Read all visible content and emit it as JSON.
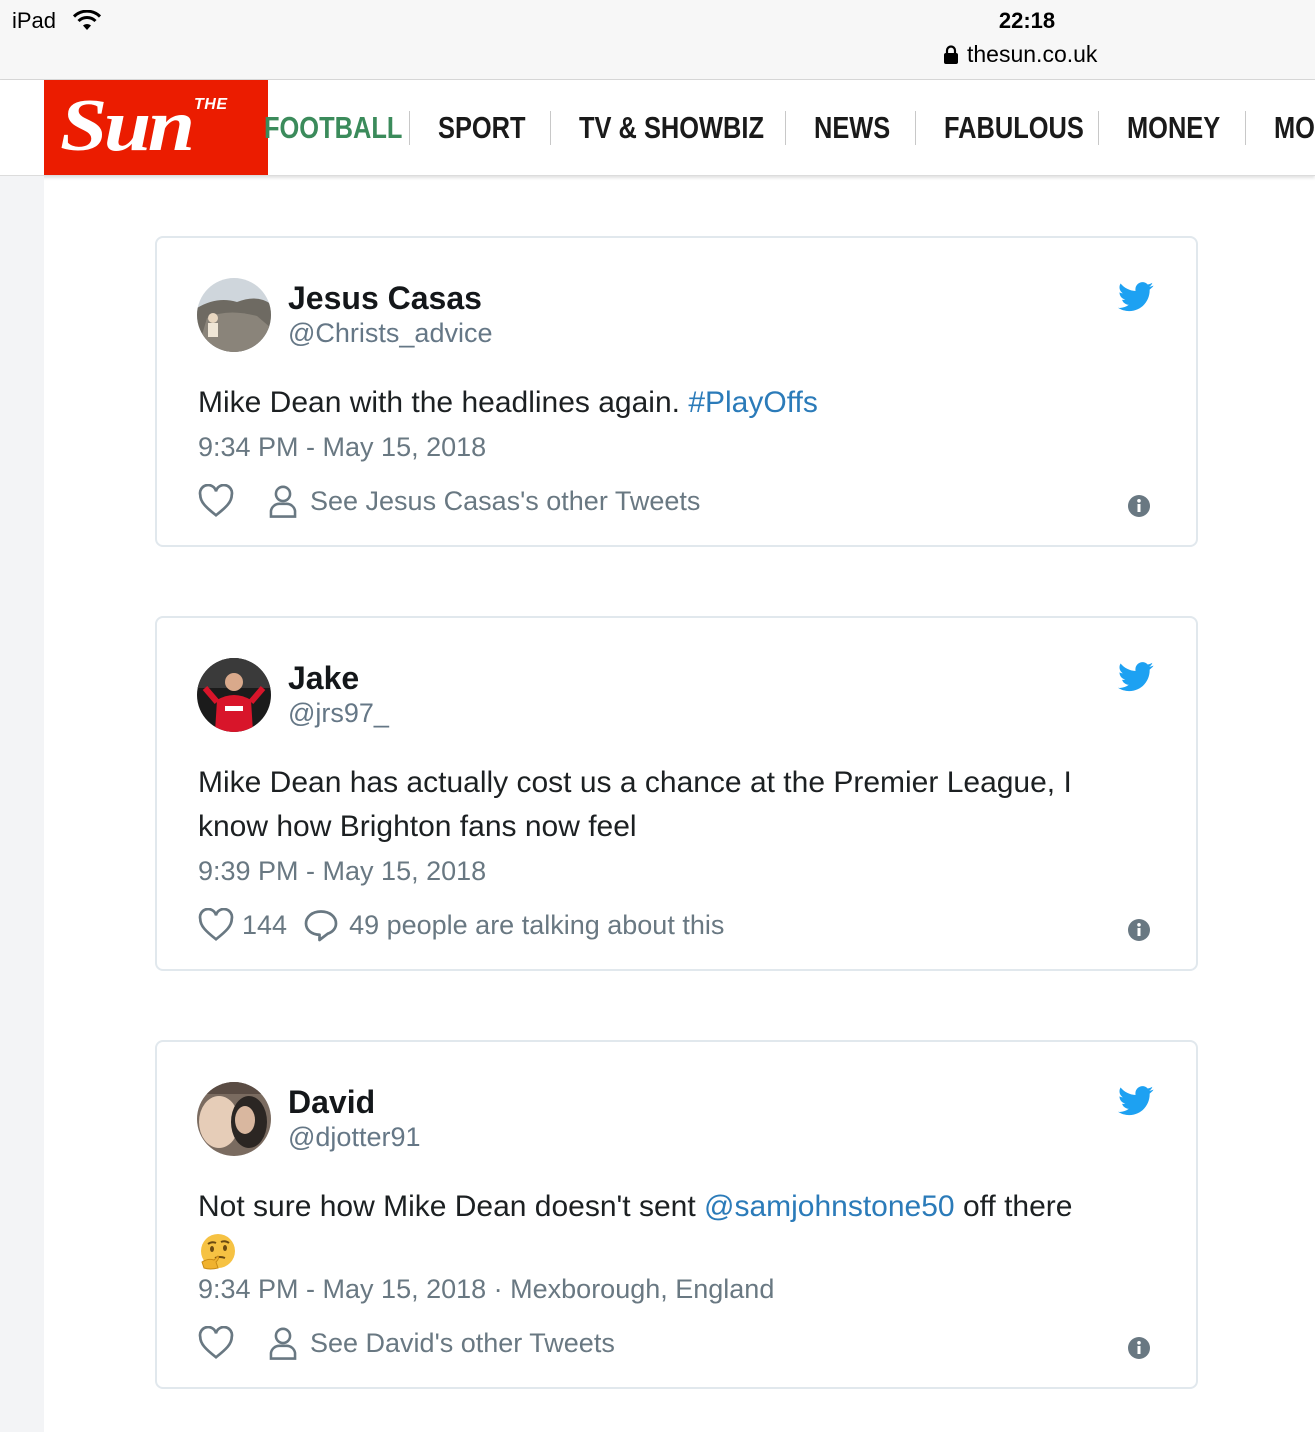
{
  "status_bar": {
    "device": "iPad",
    "time": "22:18",
    "url": "thesun.co.uk"
  },
  "brand": {
    "logo_small": "THE",
    "logo_big": "Sun",
    "color": "#eb1c00"
  },
  "nav": {
    "items": [
      "FOOTBALL",
      "SPORT",
      "TV & SHOWBIZ",
      "NEWS",
      "FABULOUS",
      "MONEY",
      "MO"
    ],
    "active_color": "#3b8b5b"
  },
  "tweets": [
    {
      "name": "Jesus Casas",
      "handle": "@Christs_advice",
      "text_plain": "Mike Dean with the headlines again. ",
      "text_link": "#PlayOffs",
      "timestamp": "9:34 PM - May 15, 2018",
      "action": "See Jesus Casas's other Tweets"
    },
    {
      "name": "Jake",
      "handle": "@jrs97_",
      "text_line1": "Mike Dean has actually cost us a chance at the Premier League, I",
      "text_line2": "know how Brighton fans now feel",
      "timestamp": "9:39 PM - May 15, 2018",
      "likes": "144",
      "action": "49 people are talking about this"
    },
    {
      "name": "David",
      "handle": "@djotter91",
      "text_plain": "Not sure how Mike Dean doesn't sent ",
      "text_link": "@samjohnstone50",
      "text_after": " off there",
      "emoji": "thinking-face",
      "timestamp": "9:34 PM - May 15, 2018 · Mexborough, England",
      "action": "See David's other Tweets"
    }
  ],
  "colors": {
    "link": "#2b7bb9",
    "twitter_blue": "#1da1f2",
    "meta": "#697882"
  }
}
